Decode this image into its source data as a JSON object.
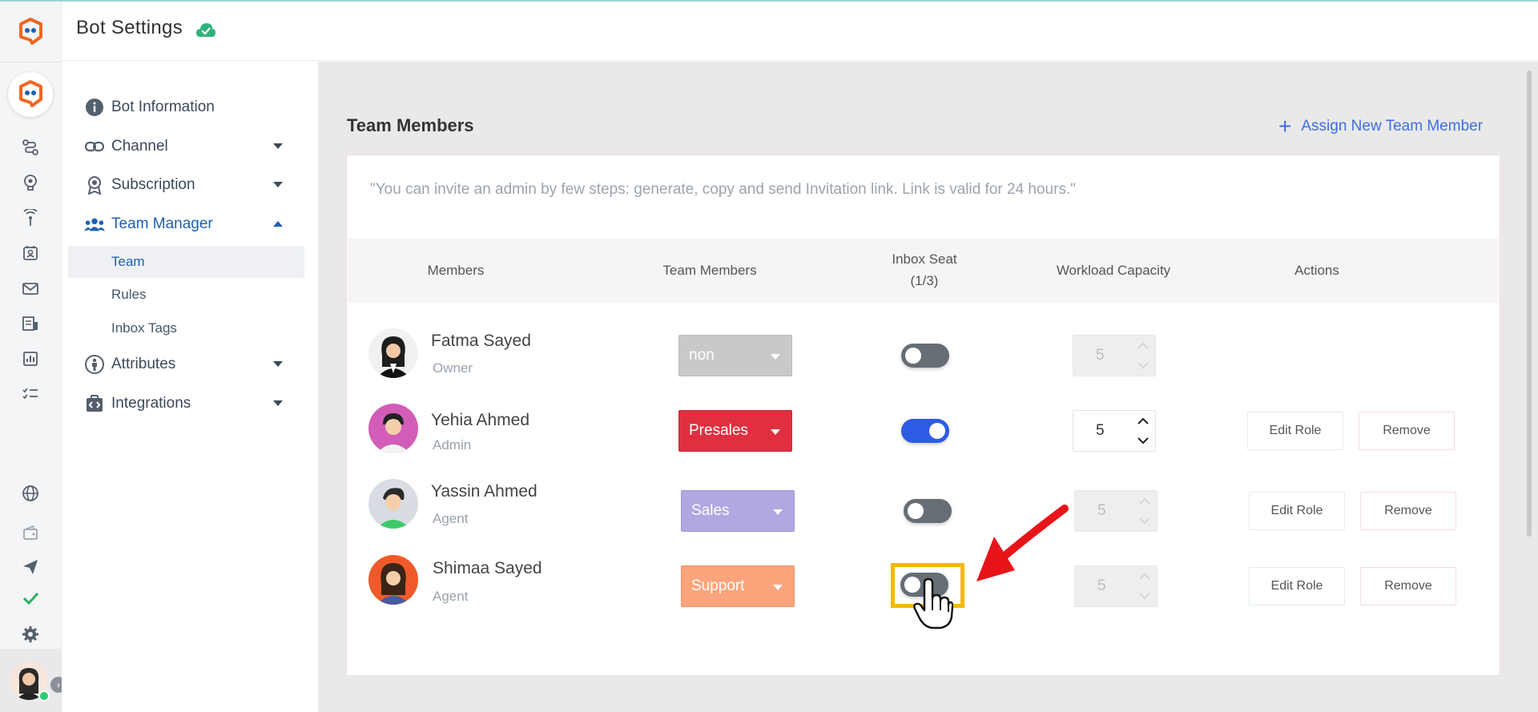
{
  "header": {
    "title": "Bot Settings",
    "status_icon": "cloud-check-icon"
  },
  "rail": {
    "icons": [
      "flow-icon",
      "bulb-icon",
      "broadcast-icon",
      "contacts-icon",
      "mail-icon",
      "forms-icon",
      "analytics-icon",
      "tasks-icon",
      "globe-icon",
      "wallet-icon",
      "send-icon",
      "check-icon",
      "gear-icon"
    ],
    "expand_icon": "chevron-right-icon"
  },
  "nav": {
    "items": [
      {
        "label": "Bot Information",
        "icon": "info-icon"
      },
      {
        "label": "Channel",
        "icon": "link-icon"
      },
      {
        "label": "Subscription",
        "icon": "award-icon"
      },
      {
        "label": "Team Manager",
        "icon": "team-icon"
      },
      {
        "label": "Attributes",
        "icon": "person-icon"
      },
      {
        "label": "Integrations",
        "icon": "integrations-icon"
      }
    ],
    "sub_items": [
      "Team",
      "Rules",
      "Inbox Tags"
    ]
  },
  "section": {
    "title": "Team Members",
    "assign_label": "Assign New Team Member",
    "notice": "\"You can invite an admin by few steps: generate, copy and send Invitation link. Link is valid for 24 hours.\""
  },
  "table": {
    "headers": {
      "members": "Members",
      "team_members": "Team Members",
      "inbox_seat": "Inbox Seat",
      "inbox_seat_count": "(1/3)",
      "workload": "Workload Capacity",
      "actions": "Actions"
    },
    "edit_label": "Edit Role",
    "remove_label": "Remove",
    "rows": [
      {
        "name": "Fatma Sayed",
        "role": "Owner",
        "team": "non",
        "team_color": "#c9c9c9",
        "seat_on": false,
        "capacity": "5",
        "capacity_enabled": false,
        "actions": false
      },
      {
        "name": "Yehia Ahmed",
        "role": "Admin",
        "team": "Presales",
        "team_color": "#e03040",
        "seat_on": true,
        "capacity": "5",
        "capacity_enabled": true,
        "actions": true
      },
      {
        "name": "Yassin Ahmed",
        "role": "Agent",
        "team": "Sales",
        "team_color": "#b0a8e0",
        "seat_on": false,
        "capacity": "5",
        "capacity_enabled": false,
        "actions": true
      },
      {
        "name": "Shimaa Sayed",
        "role": "Agent",
        "team": "Support",
        "team_color": "#fca47c",
        "seat_on": false,
        "capacity": "5",
        "capacity_enabled": false,
        "actions": true
      }
    ]
  },
  "colors": {
    "accent": "#1e5fb4",
    "link": "#3f6ee0",
    "toggle_on": "#2d5be3",
    "highlight": "#f5b800",
    "arrow": "#e8141a"
  }
}
